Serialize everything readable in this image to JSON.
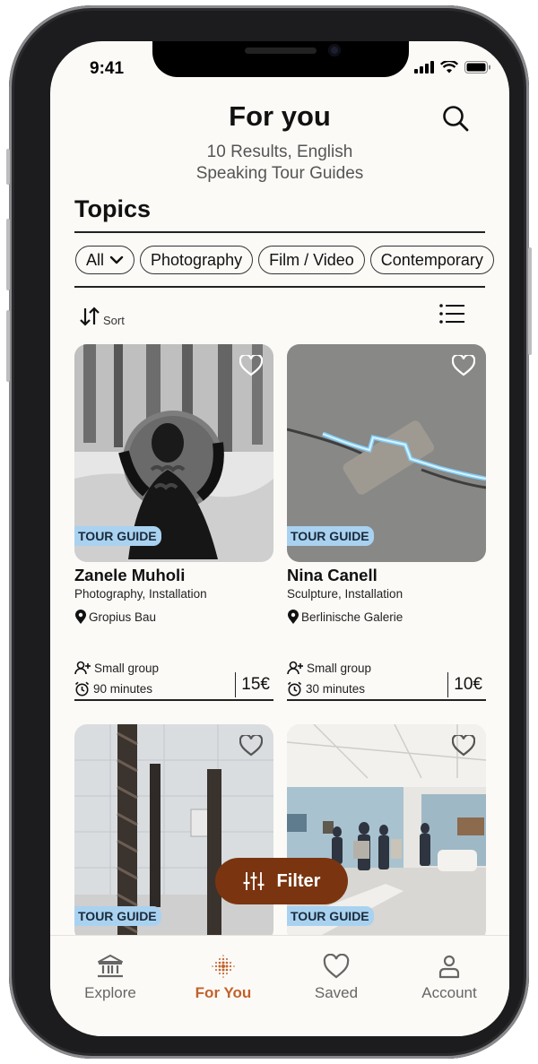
{
  "status_bar": {
    "time": "9:41"
  },
  "header": {
    "title": "For you",
    "subtitle_line1": "10 Results, English",
    "subtitle_line2": "Speaking Tour Guides"
  },
  "topics": {
    "title": "Topics",
    "chips": [
      {
        "label": "All"
      },
      {
        "label": "Photography"
      },
      {
        "label": "Film / Video"
      },
      {
        "label": "Contemporary"
      }
    ]
  },
  "toolbar": {
    "sort_label": "Sort"
  },
  "cards": [
    {
      "badge": "TOUR GUIDE",
      "name": "Zanele Muholi",
      "category": "Photography, Installation",
      "location": "Gropius Bau",
      "group": "Small group",
      "duration": "90 minutes",
      "price": "15€"
    },
    {
      "badge": "TOUR GUIDE",
      "name": "Nina Canell",
      "category": "Sculpture, Installation",
      "location": "Berlinische Galerie",
      "group": "Small group",
      "duration": "30 minutes",
      "price": "10€"
    },
    {
      "badge": "TOUR GUIDE"
    },
    {
      "badge": "TOUR GUIDE"
    }
  ],
  "filter": {
    "label": "Filter"
  },
  "nav": [
    {
      "label": "Explore",
      "icon": "museum-icon"
    },
    {
      "label": "For You",
      "icon": "dots-sunburst-icon"
    },
    {
      "label": "Saved",
      "icon": "heart-icon"
    },
    {
      "label": "Account",
      "icon": "person-icon"
    }
  ],
  "colors": {
    "accent": "#7a3510",
    "active_nav": "#c1622b",
    "badge": "#a9d2f0",
    "background": "#fcfaf7"
  }
}
